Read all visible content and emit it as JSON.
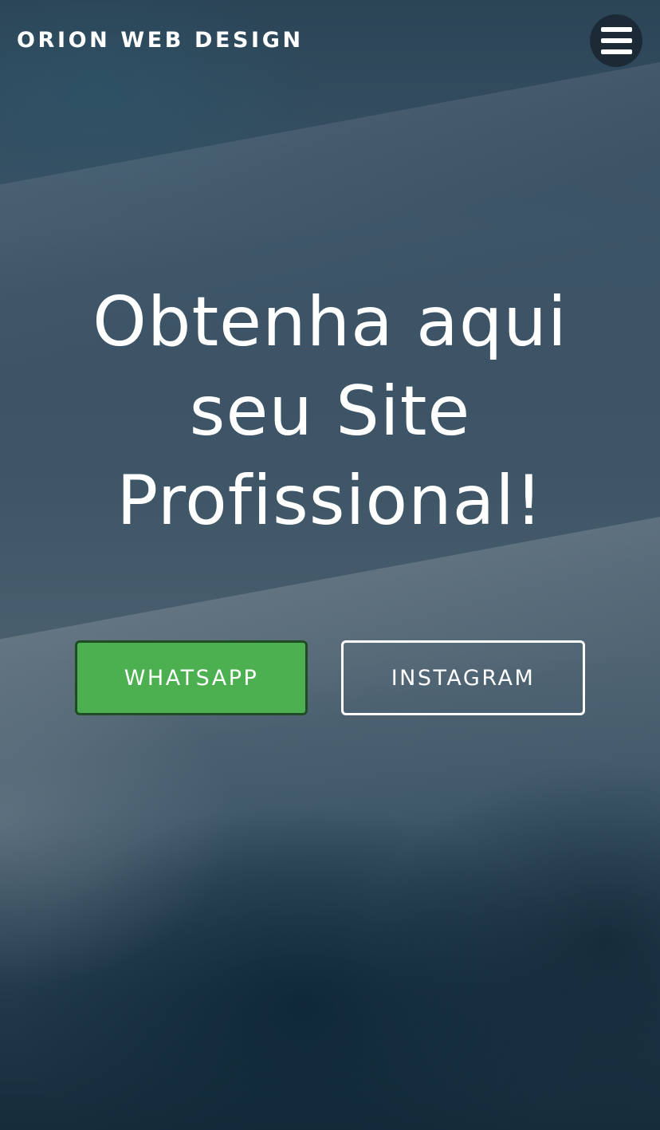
{
  "header": {
    "brand": "ORION WEB DESIGN",
    "menu_icon": "hamburger-menu-icon"
  },
  "hero": {
    "title_lines": [
      "Obtenha aqui",
      "seu Site",
      "Profissional!"
    ]
  },
  "buttons": {
    "whatsapp_label": "WHATSAPP",
    "instagram_label": "INSTAGRAM"
  },
  "colors": {
    "whatsapp_button": "#4caf50",
    "text": "#ffffff"
  }
}
